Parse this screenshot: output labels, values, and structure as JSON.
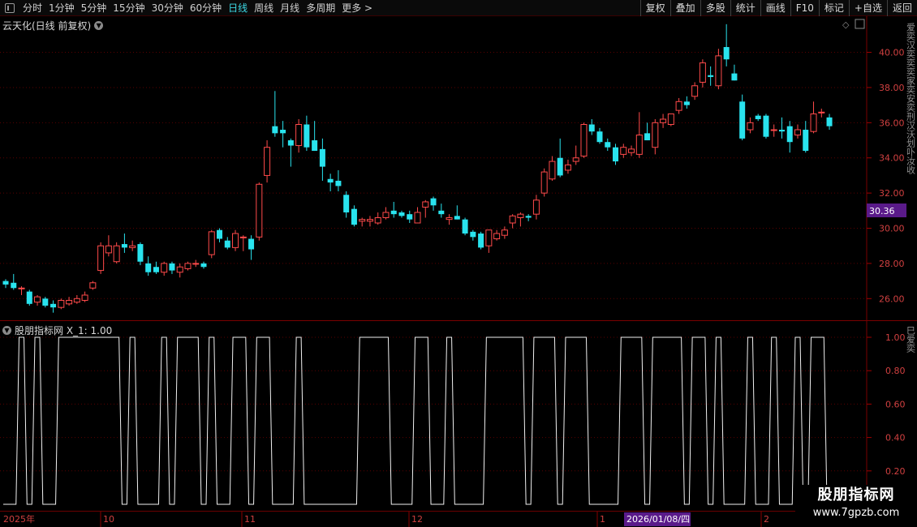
{
  "toolbar": {
    "timeframes": [
      "分时",
      "1分钟",
      "5分钟",
      "15分钟",
      "30分钟",
      "60分钟",
      "日线",
      "周线",
      "月线",
      "多周期",
      "更多 >"
    ],
    "active_index": 6,
    "right_buttons": [
      "复权",
      "叠加",
      "多股",
      "统计",
      "画线",
      "F10",
      "标记",
      "+自选",
      "返回"
    ]
  },
  "main_panel": {
    "title": "云天化(日线 前复权)",
    "current_price_label": "30.36",
    "price_axis": [
      "40.00",
      "38.00",
      "36.00",
      "34.00",
      "32.00",
      "30.00",
      "28.00",
      "26.00"
    ],
    "side_text": "爱奕汉奕奕奕家奕安奕刑汉沃划卟汝收"
  },
  "indicator_panel": {
    "title": "股朋指标网  X_1: 1.00",
    "axis": [
      "1.00",
      "0.80",
      "0.60",
      "0.40",
      "0.20"
    ],
    "side_text": "巳爱奕"
  },
  "date_axis": {
    "labels": [
      "2025年",
      "10",
      "11",
      "12",
      "1",
      "2026/01/08/四",
      "2"
    ]
  },
  "watermark": {
    "title": "股朋指标网",
    "url": "www.7gpzb.com"
  },
  "colors": {
    "up": "#ff4a4a",
    "down": "#29e3ee",
    "highlight": "#5a1a8a",
    "active": "#3dd9e6"
  },
  "chart_data": {
    "type": "candlestick",
    "ylim": [
      25,
      41.5
    ],
    "candles": [
      [
        27.0,
        27.1,
        26.6,
        26.8
      ],
      [
        26.9,
        27.4,
        26.5,
        26.6
      ],
      [
        26.6,
        26.7,
        26.2,
        26.6
      ],
      [
        26.4,
        26.5,
        25.6,
        25.7
      ],
      [
        25.8,
        26.2,
        25.6,
        26.1
      ],
      [
        26.0,
        26.1,
        25.5,
        25.6
      ],
      [
        25.7,
        25.9,
        25.2,
        25.5
      ],
      [
        25.5,
        26.0,
        25.4,
        25.9
      ],
      [
        25.7,
        26.1,
        25.6,
        25.9
      ],
      [
        25.8,
        26.2,
        25.7,
        26.0
      ],
      [
        25.9,
        26.4,
        25.8,
        26.2
      ],
      [
        26.6,
        27.0,
        26.5,
        26.9
      ],
      [
        27.6,
        29.2,
        27.4,
        29.0
      ],
      [
        28.6,
        29.6,
        28.4,
        29.0
      ],
      [
        28.1,
        29.2,
        28.0,
        29.0
      ],
      [
        29.1,
        29.7,
        28.6,
        28.9
      ],
      [
        28.9,
        29.3,
        28.7,
        29.0
      ],
      [
        29.1,
        29.2,
        27.9,
        28.1
      ],
      [
        28.0,
        28.4,
        27.3,
        27.5
      ],
      [
        27.8,
        28.1,
        27.4,
        27.5
      ],
      [
        27.5,
        28.1,
        27.3,
        28.0
      ],
      [
        28.0,
        28.1,
        27.4,
        27.6
      ],
      [
        27.5,
        28.0,
        27.2,
        27.8
      ],
      [
        27.7,
        28.1,
        27.6,
        28.0
      ],
      [
        28.0,
        28.2,
        27.8,
        28.0
      ],
      [
        28.0,
        28.1,
        27.7,
        27.8
      ],
      [
        28.5,
        29.9,
        28.3,
        29.8
      ],
      [
        29.9,
        30.0,
        29.2,
        29.4
      ],
      [
        29.3,
        29.5,
        28.8,
        28.9
      ],
      [
        28.9,
        29.9,
        28.7,
        29.7
      ],
      [
        29.5,
        29.6,
        28.7,
        29.5
      ],
      [
        29.4,
        29.6,
        28.2,
        28.8
      ],
      [
        29.5,
        32.6,
        29.3,
        32.5
      ],
      [
        33.0,
        35.0,
        32.6,
        34.6
      ],
      [
        35.8,
        37.8,
        35.2,
        35.4
      ],
      [
        35.6,
        36.1,
        34.6,
        35.4
      ],
      [
        35.0,
        35.1,
        33.5,
        34.7
      ],
      [
        34.7,
        36.2,
        34.3,
        35.9
      ],
      [
        35.9,
        36.4,
        34.4,
        34.6
      ],
      [
        35.0,
        36.1,
        34.4,
        34.4
      ],
      [
        34.5,
        35.1,
        32.7,
        33.5
      ],
      [
        32.8,
        33.1,
        32.1,
        32.6
      ],
      [
        32.7,
        33.3,
        32.1,
        32.4
      ],
      [
        31.9,
        32.1,
        30.6,
        30.9
      ],
      [
        31.1,
        31.3,
        30.1,
        30.2
      ],
      [
        30.4,
        30.6,
        30.1,
        30.5
      ],
      [
        30.4,
        30.7,
        30.1,
        30.5
      ],
      [
        30.3,
        30.9,
        30.2,
        30.6
      ],
      [
        30.6,
        31.2,
        30.5,
        30.9
      ],
      [
        31.0,
        31.5,
        30.6,
        30.8
      ],
      [
        30.9,
        31.0,
        30.6,
        30.7
      ],
      [
        30.8,
        31.0,
        30.3,
        30.5
      ],
      [
        30.3,
        31.2,
        30.3,
        30.9
      ],
      [
        31.2,
        31.6,
        30.6,
        31.5
      ],
      [
        31.7,
        31.8,
        31.0,
        31.3
      ],
      [
        31.0,
        31.4,
        30.6,
        30.8
      ],
      [
        30.5,
        30.8,
        30.2,
        30.6
      ],
      [
        30.7,
        31.3,
        30.5,
        30.5
      ],
      [
        30.5,
        30.6,
        29.6,
        29.7
      ],
      [
        29.8,
        29.9,
        29.3,
        29.5
      ],
      [
        29.7,
        29.8,
        28.8,
        28.9
      ],
      [
        29.0,
        29.9,
        28.6,
        29.9
      ],
      [
        29.4,
        29.9,
        29.3,
        29.7
      ],
      [
        29.6,
        30.1,
        29.4,
        29.9
      ],
      [
        30.3,
        30.8,
        30.0,
        30.7
      ],
      [
        30.6,
        30.9,
        30.1,
        30.8
      ],
      [
        30.7,
        30.8,
        30.4,
        30.6
      ],
      [
        30.8,
        31.9,
        30.5,
        31.6
      ],
      [
        32.0,
        33.4,
        31.8,
        33.2
      ],
      [
        32.8,
        34.1,
        32.7,
        33.8
      ],
      [
        34.0,
        35.1,
        32.9,
        33.0
      ],
      [
        33.3,
        33.9,
        33.1,
        33.6
      ],
      [
        33.8,
        34.7,
        33.6,
        34.0
      ],
      [
        34.1,
        36.0,
        34.0,
        35.9
      ],
      [
        35.9,
        36.2,
        35.3,
        35.5
      ],
      [
        35.5,
        35.7,
        34.8,
        34.9
      ],
      [
        34.9,
        35.1,
        34.4,
        34.6
      ],
      [
        34.6,
        34.8,
        33.6,
        33.8
      ],
      [
        34.2,
        34.8,
        34.0,
        34.6
      ],
      [
        34.3,
        34.7,
        34.1,
        34.5
      ],
      [
        34.2,
        36.6,
        34.0,
        35.3
      ],
      [
        35.4,
        36.0,
        35.0,
        35.0
      ],
      [
        34.6,
        36.2,
        34.2,
        36.0
      ],
      [
        36.0,
        36.5,
        35.7,
        36.2
      ],
      [
        35.9,
        36.5,
        35.8,
        36.5
      ],
      [
        36.7,
        37.4,
        36.5,
        37.2
      ],
      [
        37.2,
        37.5,
        36.8,
        37.0
      ],
      [
        37.5,
        38.3,
        37.3,
        38.1
      ],
      [
        38.3,
        39.6,
        38.0,
        39.4
      ],
      [
        38.7,
        39.2,
        38.1,
        38.6
      ],
      [
        38.1,
        40.2,
        37.9,
        39.8
      ],
      [
        40.3,
        41.6,
        39.2,
        39.6
      ],
      [
        38.8,
        39.3,
        38.4,
        38.4
      ],
      [
        37.2,
        37.6,
        35.0,
        35.1
      ],
      [
        35.6,
        36.3,
        35.4,
        36.0
      ],
      [
        36.4,
        36.5,
        36.1,
        36.2
      ],
      [
        36.4,
        36.5,
        35.1,
        35.2
      ],
      [
        35.6,
        35.9,
        35.2,
        35.6
      ],
      [
        35.6,
        36.3,
        35.1,
        35.5
      ],
      [
        35.8,
        36.1,
        34.3,
        34.9
      ],
      [
        35.3,
        35.9,
        35.1,
        35.6
      ],
      [
        35.6,
        36.1,
        34.3,
        34.4
      ],
      [
        35.5,
        37.2,
        35.4,
        36.5
      ],
      [
        36.6,
        36.8,
        36.3,
        36.6
      ],
      [
        36.3,
        36.5,
        35.6,
        35.8
      ]
    ]
  }
}
